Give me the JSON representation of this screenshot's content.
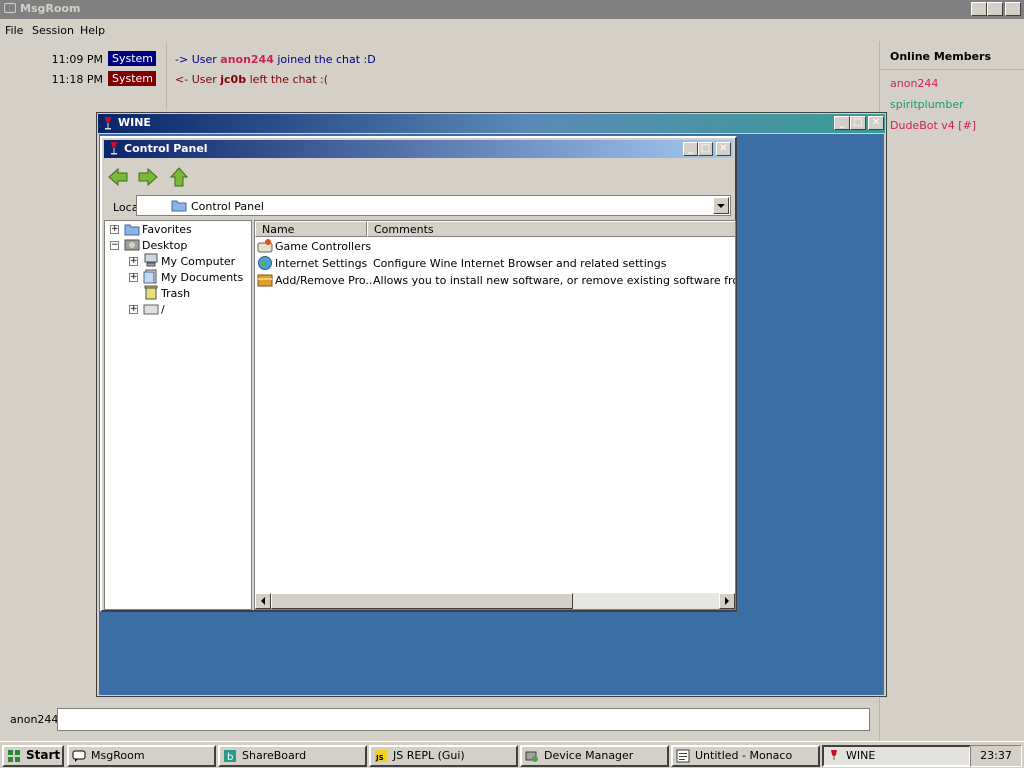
{
  "app": {
    "title": "MsgRoom",
    "menu": [
      "File",
      "Session",
      "Help"
    ]
  },
  "chat": {
    "messages": [
      {
        "time": "11:09 PM",
        "tag": "System",
        "tag_color": "#000080",
        "arrow": "->",
        "pre": "User",
        "user": "anon244",
        "post": "joined the chat :D",
        "color": "#000080",
        "user_color": "#cc2255"
      },
      {
        "time": "11:18 PM",
        "tag": "System",
        "tag_color": "#800000",
        "arrow": "<-",
        "pre": "User",
        "user": "jc0b",
        "post": "left the chat :(",
        "color": "#800000",
        "user_color": "#800000"
      }
    ]
  },
  "members": {
    "title": "Online Members",
    "list": [
      {
        "name": "anon244",
        "color": "#cc2255"
      },
      {
        "name": "spiritplumber",
        "color": "#1a9a6a"
      },
      {
        "name": "DudeBot v4 [#]",
        "color": "#cc2255"
      }
    ]
  },
  "input": {
    "username": "anon244",
    "value": ""
  },
  "wine": {
    "title": "WINE"
  },
  "control_panel": {
    "title": "Control Panel",
    "location_label": "Location:",
    "location_value": "Control Panel",
    "tree": {
      "favorites": "Favorites",
      "desktop": "Desktop",
      "my_computer": "My Computer",
      "my_documents": "My Documents",
      "trash": "Trash",
      "root": "/"
    },
    "columns": {
      "name": "Name",
      "comments": "Comments"
    },
    "items": [
      {
        "name": "Game Controllers",
        "comment": ""
      },
      {
        "name": "Internet Settings",
        "comment": "Configure Wine Internet Browser and related settings"
      },
      {
        "name": "Add/Remove Pro...",
        "comment": "Allows you to install new software, or remove existing software from your c"
      }
    ]
  },
  "taskbar": {
    "start": "Start",
    "tasks": [
      "MsgRoom",
      "ShareBoard",
      "JS REPL (Gui)",
      "Device Manager",
      "Untitled - Monaco",
      "WINE"
    ],
    "clock": "23:37"
  }
}
